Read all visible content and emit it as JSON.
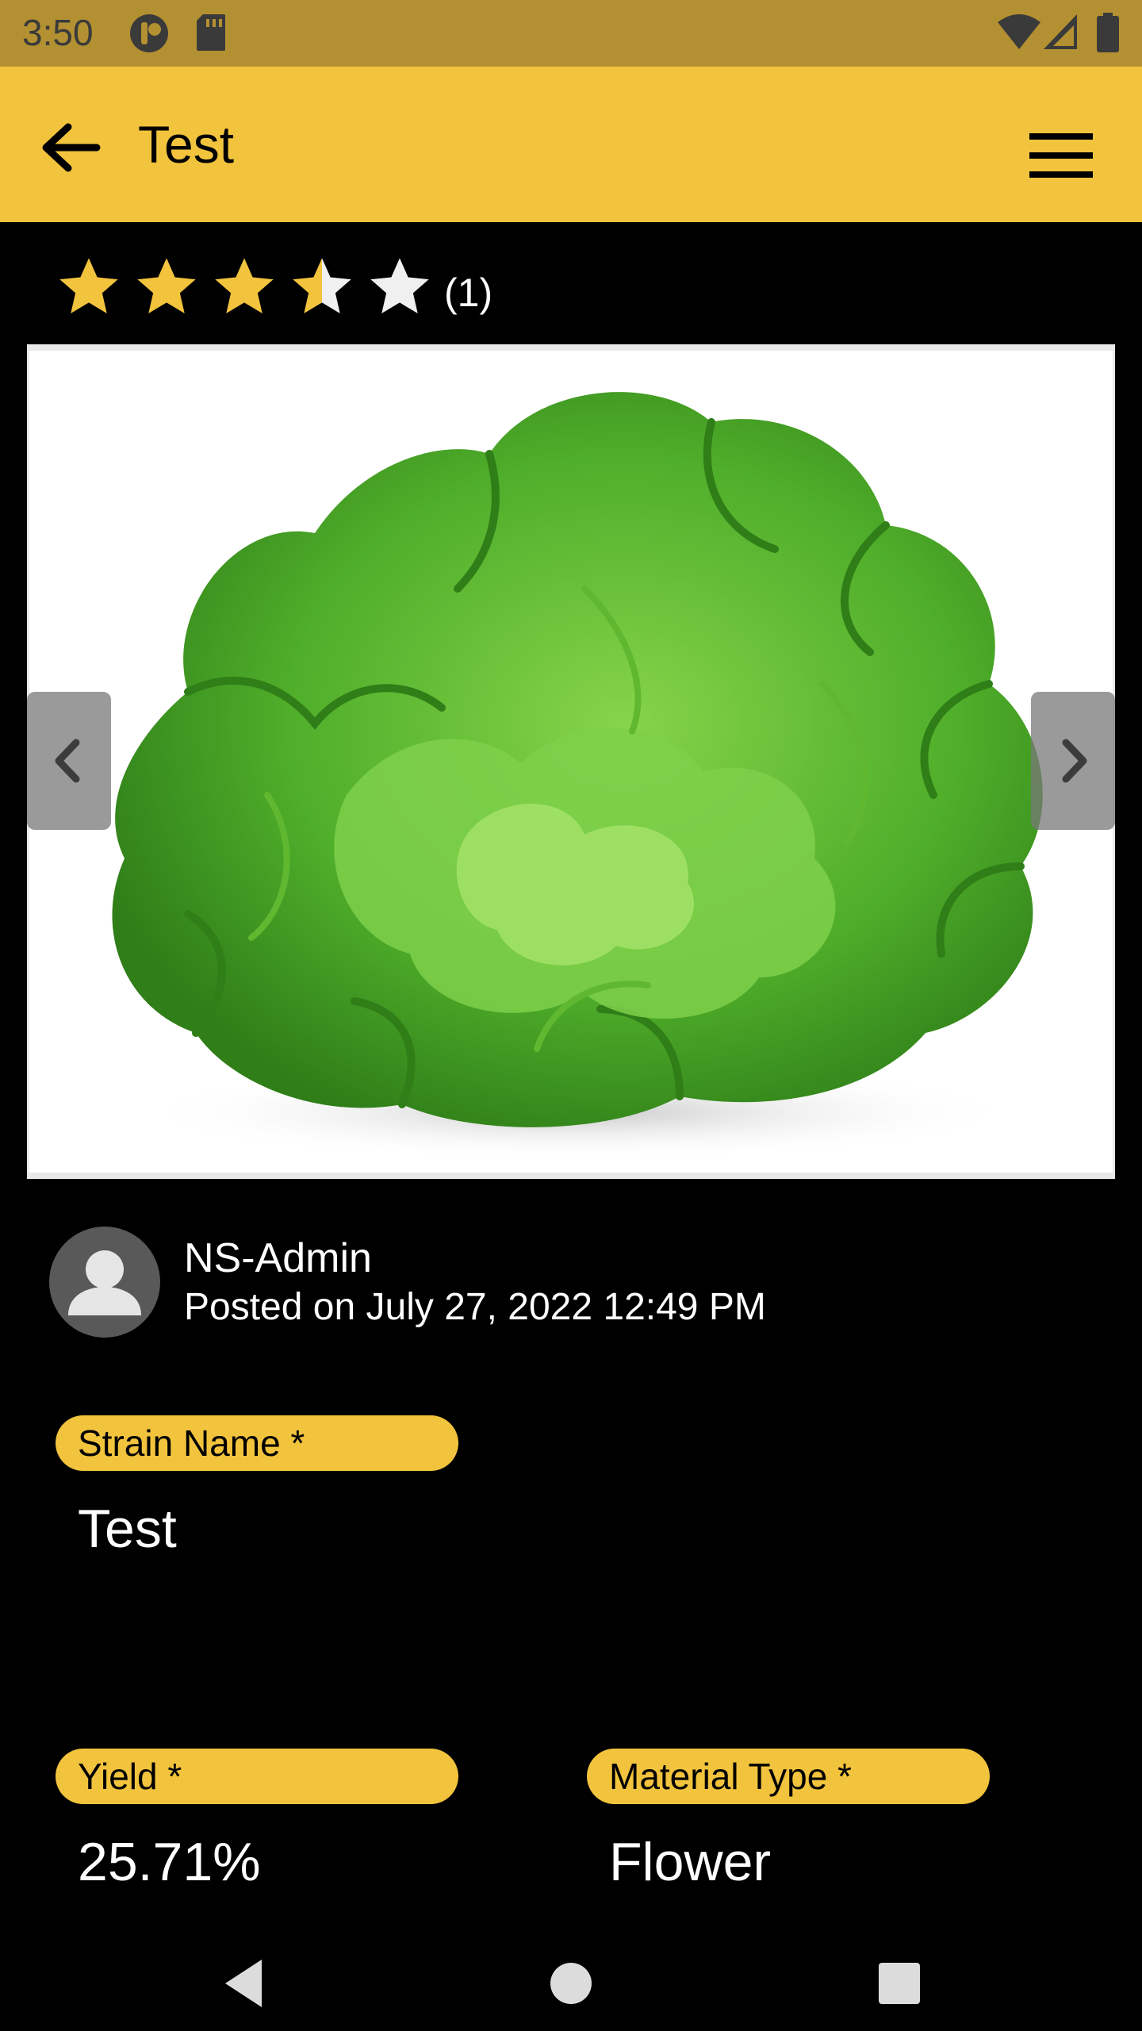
{
  "status_bar": {
    "time": "3:50",
    "icons": [
      "app-notification-icon",
      "sd-card-icon",
      "wifi-icon",
      "signal-icon",
      "battery-icon"
    ]
  },
  "app_bar": {
    "title": "Test",
    "back_icon": "arrow-back-icon",
    "menu_icon": "hamburger-menu-icon",
    "background_color": "#f2c33d"
  },
  "rating": {
    "value": 3.5,
    "max": 5,
    "count_label": "(1)",
    "star_color": "#f2c33d"
  },
  "carousel": {
    "image_alt": "green lettuce",
    "prev_icon": "chevron-left-icon",
    "next_icon": "chevron-right-icon"
  },
  "post": {
    "author": "NS-Admin",
    "posted_on": "Posted on July 27, 2022 12:49 PM"
  },
  "fields": {
    "strain_name": {
      "label": "Strain Name *",
      "value": "Test"
    },
    "yield": {
      "label": "Yield *",
      "value": "25.71%"
    },
    "material_type": {
      "label": "Material Type *",
      "value": "Flower"
    }
  },
  "system_nav": {
    "icons": [
      "nav-back-icon",
      "nav-home-icon",
      "nav-recents-icon"
    ]
  }
}
